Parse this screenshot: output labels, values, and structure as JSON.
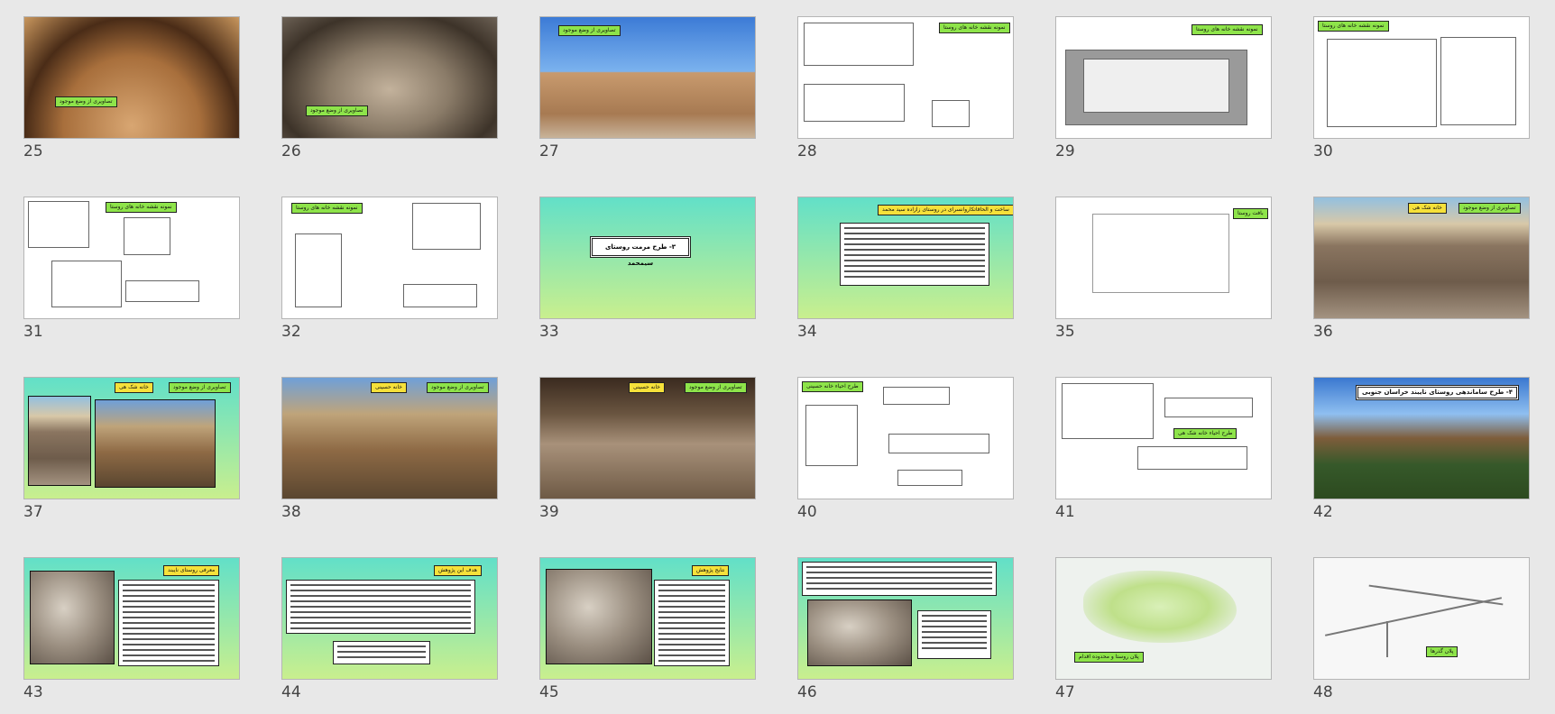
{
  "slides": [
    {
      "number": "25",
      "tags": [
        {
          "text": "تصاویری از وضع موجود",
          "color": "green"
        }
      ]
    },
    {
      "number": "26",
      "tags": [
        {
          "text": "تصاویری از وضع موجود",
          "color": "green"
        }
      ]
    },
    {
      "number": "27",
      "tags": [
        {
          "text": "تصاویری از وضع موجود",
          "color": "green"
        }
      ]
    },
    {
      "number": "28",
      "tags": [
        {
          "text": "نمونه نقشه خانه های روستا",
          "color": "green"
        }
      ]
    },
    {
      "number": "29",
      "tags": [
        {
          "text": "نمونه نقشه خانه های روستا",
          "color": "green"
        }
      ]
    },
    {
      "number": "30",
      "tags": [
        {
          "text": "نمونه نقشه خانه های روستا",
          "color": "green"
        }
      ]
    },
    {
      "number": "31",
      "tags": [
        {
          "text": "نمونه نقشه خانه های روستا",
          "color": "green"
        }
      ]
    },
    {
      "number": "32",
      "tags": [
        {
          "text": "نمونه نقشه خانه های روستا",
          "color": "green"
        }
      ]
    },
    {
      "number": "33",
      "title": "۳- طرح مرمت روستای سیمحمد"
    },
    {
      "number": "34",
      "tags": [
        {
          "text": "ساخت و الحاقاتکاروانسرای در روستای زازاده سید محمد",
          "color": "yellow"
        }
      ]
    },
    {
      "number": "35",
      "tags": [
        {
          "text": "بافت روستا",
          "color": "green"
        }
      ]
    },
    {
      "number": "36",
      "tags": [
        {
          "text": "تصاویری از وضع موجود",
          "color": "green"
        },
        {
          "text": "خانه شک هی",
          "color": "yellow"
        }
      ]
    },
    {
      "number": "37",
      "tags": [
        {
          "text": "تصاویری از وضع موجود",
          "color": "green"
        },
        {
          "text": "خانه شک هی",
          "color": "yellow"
        }
      ]
    },
    {
      "number": "38",
      "tags": [
        {
          "text": "تصاویری از وضع موجود",
          "color": "green"
        },
        {
          "text": "خانه حسینی",
          "color": "yellow"
        }
      ]
    },
    {
      "number": "39",
      "tags": [
        {
          "text": "تصاویری از وضع موجود",
          "color": "green"
        },
        {
          "text": "خانه حسینی",
          "color": "yellow"
        }
      ]
    },
    {
      "number": "40",
      "tags": [
        {
          "text": "طرح احیاء خانه حسینی",
          "color": "green"
        }
      ]
    },
    {
      "number": "41",
      "tags": [
        {
          "text": "طرح احیاء خانه شک هی",
          "color": "green"
        }
      ]
    },
    {
      "number": "42",
      "title": "۴- طرح ساماندهی روستای نایبند خراسان جنوبی"
    },
    {
      "number": "43",
      "tags": [
        {
          "text": "معرفی روستای نایبند",
          "color": "yellow"
        }
      ]
    },
    {
      "number": "44",
      "tags": [
        {
          "text": "هدف این پژوهش",
          "color": "yellow"
        }
      ]
    },
    {
      "number": "45",
      "tags": [
        {
          "text": "نتایج پژوهش",
          "color": "yellow"
        }
      ]
    },
    {
      "number": "46"
    },
    {
      "number": "47",
      "tags": [
        {
          "text": "پلان روستا و محدوده اقدام",
          "color": "green"
        }
      ]
    },
    {
      "number": "48",
      "tags": [
        {
          "text": "پلان گذرها",
          "color": "green"
        }
      ]
    }
  ]
}
